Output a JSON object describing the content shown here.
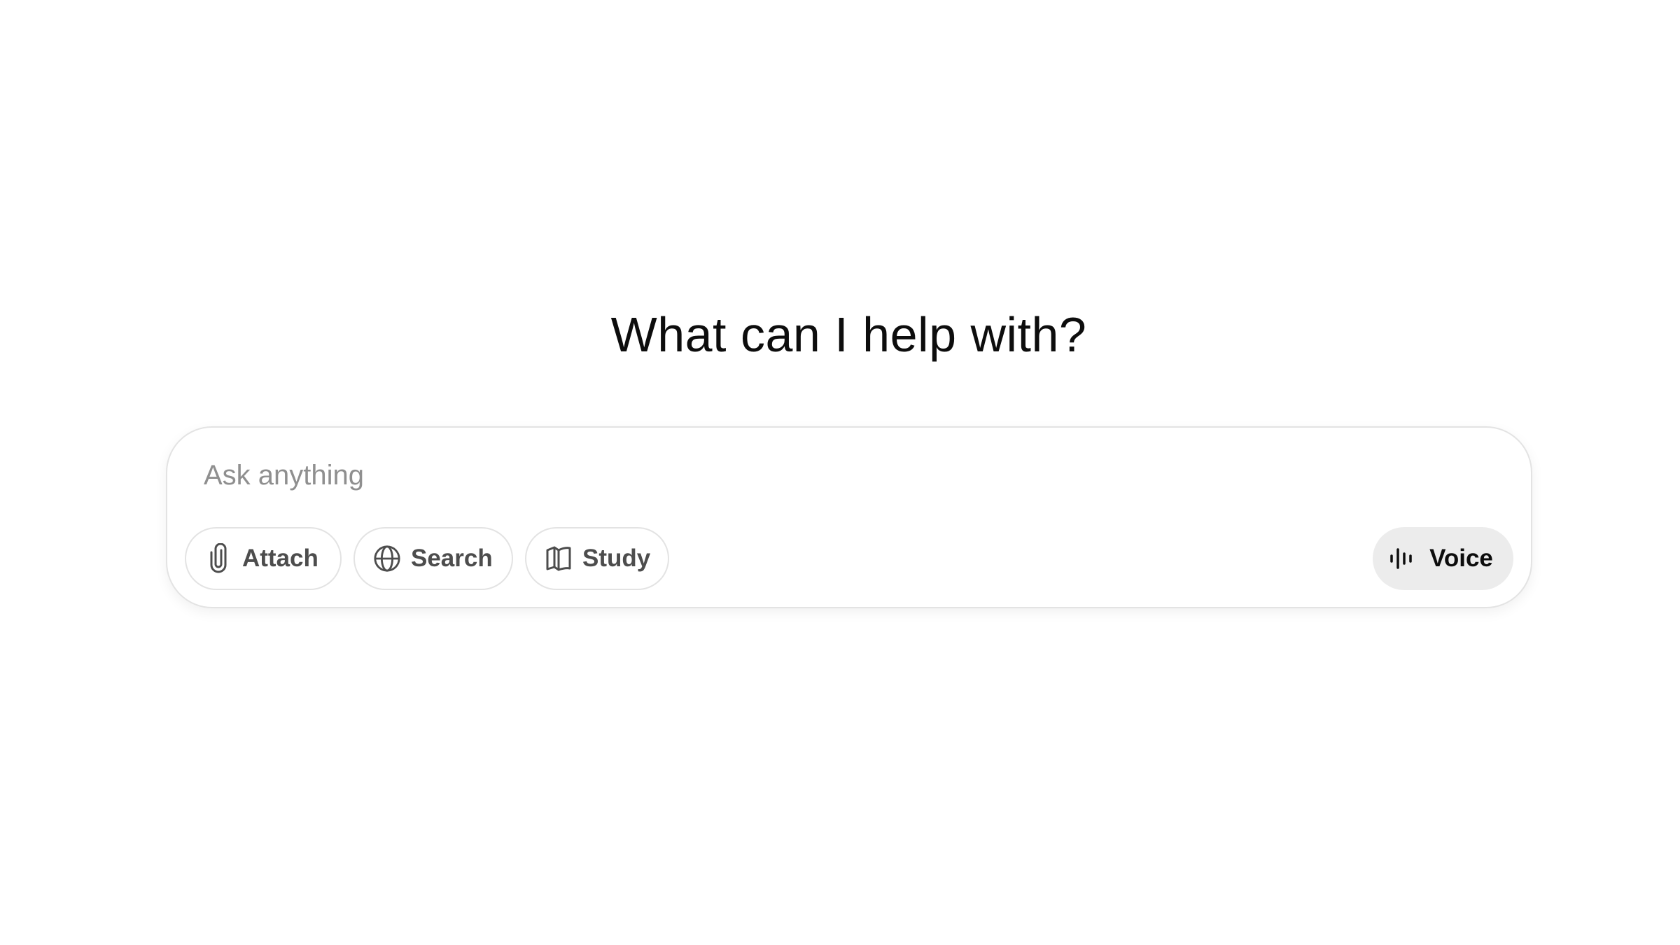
{
  "main": {
    "heading": "What can I help with?"
  },
  "composer": {
    "placeholder": "Ask anything",
    "value": "",
    "tools": [
      {
        "label": "Attach",
        "icon": "paperclip-icon"
      },
      {
        "label": "Search",
        "icon": "globe-icon"
      },
      {
        "label": "Study",
        "icon": "open-book-icon"
      }
    ],
    "voice": {
      "label": "Voice",
      "icon": "waveform-icon"
    }
  },
  "colors": {
    "background": "#ffffff",
    "text": "#0d0d0d",
    "pill_border": "#e3e3e3",
    "pill_text": "#4d4d4d",
    "placeholder": "#8f8f8f",
    "voice_background": "#ececec"
  }
}
